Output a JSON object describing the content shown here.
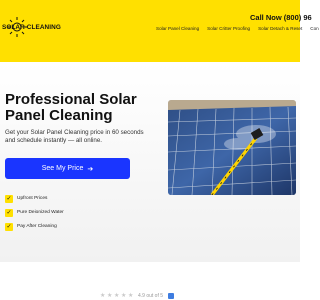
{
  "header": {
    "logo_text": "SOLAR CLEANING",
    "call_now": "Call Now (800) 96",
    "nav": [
      {
        "label": "Solar Panel Cleaning"
      },
      {
        "label": "Solar Critter Proofing"
      },
      {
        "label": "Solar Detach & Reset"
      },
      {
        "label": "Con"
      }
    ]
  },
  "hero": {
    "title": "Professional Solar Panel Cleaning",
    "subtitle": "Get your Solar Panel Cleaning price in 60 seconds and schedule instantly — all online.",
    "cta_label": "See My Price",
    "features": [
      {
        "label": "Upfront Prices"
      },
      {
        "label": "Pure Deionized Water"
      },
      {
        "label": "Pay After Cleaning"
      }
    ]
  },
  "rating": {
    "stars": 5,
    "text": "4.9 out of 5"
  },
  "colors": {
    "header_bg": "#ffe000",
    "cta_bg": "#1a35ff"
  }
}
